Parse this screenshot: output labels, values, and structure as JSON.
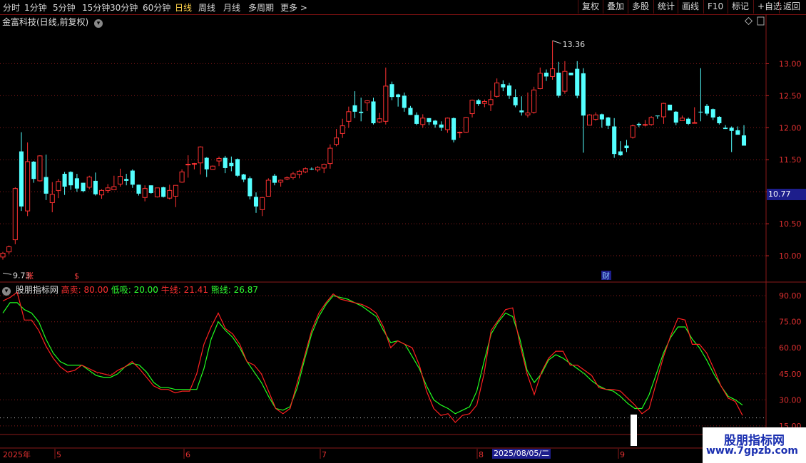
{
  "toolbar": {
    "periods": [
      "分时",
      "1分钟",
      "5分钟",
      "15分钟",
      "30分钟",
      "60分钟",
      "日线",
      "周线",
      "月线",
      "多周期",
      "更多 >"
    ],
    "active_period": "日线",
    "actions": [
      "复权",
      "叠加",
      "多股",
      "统计",
      "画线",
      "F10",
      "标记",
      "+自选",
      "返回"
    ]
  },
  "chart_title": "金富科技(日线,前复权)",
  "indicator": {
    "name": "股朋指标网",
    "items": [
      {
        "label": "高卖: 80.00",
        "color": "#ff3030"
      },
      {
        "label": "低吸: 20.00",
        "color": "#30ff30"
      },
      {
        "label": "牛线: 21.41",
        "color": "#ff3030"
      },
      {
        "label": "熊线: 26.87",
        "color": "#30ff30"
      }
    ]
  },
  "current_price": "10.77",
  "markers": {
    "high": "13.36",
    "low": "9.73",
    "tag1": "涨",
    "tag2": "$",
    "tag3": "财"
  },
  "date_axis": {
    "start": "2025年",
    "months": [
      "5",
      "6",
      "7",
      "8",
      "9"
    ],
    "cursor_date": "2025/08/05/二"
  },
  "watermark": {
    "line1": "股朋指标网",
    "line2": "www.7gpzb.com"
  },
  "colors": {
    "up": "#ff3232",
    "down": "#54ffff",
    "bull": "#ff2020",
    "bear": "#20ff20",
    "grid": "#8a1a1a"
  },
  "chart_data": {
    "type": "candlestick",
    "price_ticks": [
      10.0,
      10.5,
      11.0,
      11.5,
      12.0,
      12.5,
      13.0
    ],
    "price_ylim": [
      9.6,
      13.55
    ],
    "indicator_ticks": [
      15.0,
      30.0,
      45.0,
      60.0,
      75.0,
      90.0
    ],
    "indicator_ylim": [
      10,
      95
    ],
    "candles": [
      [
        9.98,
        10.04,
        9.94,
        10.06
      ],
      [
        10.06,
        10.14,
        10.02,
        10.16
      ],
      [
        10.25,
        11.05,
        10.18,
        11.07
      ],
      [
        11.63,
        10.77,
        10.7,
        11.93
      ],
      [
        10.7,
        11.47,
        10.62,
        11.77
      ],
      [
        11.47,
        11.2,
        11.14,
        11.48
      ],
      [
        11.17,
        11.56,
        11.16,
        11.57
      ],
      [
        11.23,
        10.97,
        10.87,
        11.58
      ],
      [
        10.83,
        10.96,
        10.68,
        11.15
      ],
      [
        11.02,
        11.16,
        10.9,
        11.2
      ],
      [
        11.28,
        11.08,
        10.95,
        11.31
      ],
      [
        11.31,
        11.1,
        11.03,
        11.32
      ],
      [
        11.21,
        11.05,
        11.0,
        11.28
      ],
      [
        11.14,
        11.01,
        10.99,
        11.14
      ],
      [
        11.07,
        11.23,
        11.04,
        11.25
      ],
      [
        11.17,
        10.96,
        10.94,
        11.3
      ],
      [
        10.95,
        11.02,
        10.89,
        11.04
      ],
      [
        11.02,
        11.06,
        10.98,
        11.12
      ],
      [
        11.03,
        11.08,
        11.03,
        11.25
      ],
      [
        11.12,
        11.24,
        11.08,
        11.36
      ],
      [
        11.2,
        11.17,
        11.1,
        11.28
      ],
      [
        11.33,
        11.11,
        11.06,
        11.35
      ],
      [
        11.11,
        10.97,
        10.94,
        11.11
      ],
      [
        10.91,
        11.05,
        10.85,
        11.1
      ],
      [
        11.1,
        10.98,
        10.97,
        11.1
      ],
      [
        10.92,
        11.06,
        10.91,
        11.06
      ],
      [
        11.07,
        10.92,
        10.91,
        11.08
      ],
      [
        10.9,
        11.02,
        10.88,
        11.11
      ],
      [
        10.93,
        11.1,
        10.76,
        11.1
      ],
      [
        11.15,
        11.31,
        11.14,
        11.35
      ],
      [
        11.43,
        11.43,
        11.22,
        11.57
      ],
      [
        11.43,
        11.44,
        11.35,
        11.45
      ],
      [
        11.45,
        11.7,
        11.27,
        11.71
      ],
      [
        11.53,
        11.35,
        11.23,
        11.54
      ],
      [
        11.35,
        11.4,
        11.37,
        11.41
      ],
      [
        11.48,
        11.52,
        11.4,
        11.55
      ],
      [
        11.53,
        11.37,
        11.29,
        11.56
      ],
      [
        11.45,
        11.4,
        11.32,
        11.55
      ],
      [
        11.51,
        11.25,
        11.23,
        11.52
      ],
      [
        11.27,
        11.19,
        11.15,
        11.28
      ],
      [
        11.21,
        10.93,
        10.88,
        11.24
      ],
      [
        10.92,
        10.77,
        10.67,
        10.99
      ],
      [
        10.72,
        10.91,
        10.62,
        10.92
      ],
      [
        10.93,
        11.18,
        10.93,
        11.21
      ],
      [
        11.25,
        11.14,
        11.1,
        11.28
      ],
      [
        11.15,
        11.18,
        11.08,
        11.19
      ],
      [
        11.2,
        11.22,
        11.18,
        11.24
      ],
      [
        11.22,
        11.28,
        11.19,
        11.31
      ],
      [
        11.27,
        11.32,
        11.21,
        11.34
      ],
      [
        11.31,
        11.36,
        11.29,
        11.38
      ],
      [
        11.36,
        11.35,
        11.34,
        11.38
      ],
      [
        11.34,
        11.38,
        11.31,
        11.4
      ],
      [
        11.37,
        11.43,
        11.29,
        11.44
      ],
      [
        11.44,
        11.68,
        11.36,
        11.74
      ],
      [
        11.74,
        11.84,
        11.71,
        11.98
      ],
      [
        11.91,
        12.03,
        11.84,
        12.14
      ],
      [
        12.1,
        12.25,
        12.0,
        12.33
      ],
      [
        12.35,
        12.25,
        12.15,
        12.57
      ],
      [
        12.25,
        12.23,
        12.1,
        12.47
      ],
      [
        12.39,
        12.42,
        12.26,
        12.43
      ],
      [
        12.41,
        12.07,
        12.05,
        12.47
      ],
      [
        12.09,
        12.14,
        12.07,
        12.23
      ],
      [
        12.1,
        12.65,
        12.05,
        12.94
      ],
      [
        12.68,
        12.48,
        12.43,
        12.72
      ],
      [
        12.52,
        12.48,
        12.33,
        12.53
      ],
      [
        12.5,
        12.31,
        12.25,
        12.55
      ],
      [
        12.31,
        12.2,
        12.2,
        12.34
      ],
      [
        12.2,
        12.06,
        12.04,
        12.24
      ],
      [
        12.05,
        12.15,
        12.0,
        12.21
      ],
      [
        12.15,
        12.09,
        12.04,
        12.15
      ],
      [
        12.11,
        12.05,
        12.0,
        12.12
      ],
      [
        12.05,
        12.0,
        11.95,
        12.1
      ],
      [
        11.97,
        12.15,
        11.92,
        12.16
      ],
      [
        12.15,
        11.81,
        11.77,
        12.16
      ],
      [
        11.93,
        11.93,
        11.84,
        11.94
      ],
      [
        11.93,
        12.16,
        11.92,
        12.17
      ],
      [
        12.22,
        12.43,
        12.16,
        12.44
      ],
      [
        12.43,
        12.37,
        12.34,
        12.45
      ],
      [
        12.38,
        12.41,
        12.32,
        12.44
      ],
      [
        12.36,
        12.44,
        12.26,
        12.58
      ],
      [
        12.49,
        12.7,
        12.47,
        12.77
      ],
      [
        12.68,
        12.63,
        12.57,
        12.74
      ],
      [
        12.66,
        12.5,
        12.45,
        12.7
      ],
      [
        12.48,
        12.35,
        12.32,
        12.6
      ],
      [
        12.27,
        12.24,
        12.19,
        12.49
      ],
      [
        12.2,
        12.23,
        12.16,
        12.55
      ],
      [
        12.24,
        12.59,
        12.22,
        12.64
      ],
      [
        12.61,
        12.85,
        12.6,
        12.94
      ],
      [
        12.86,
        12.8,
        12.73,
        12.91
      ],
      [
        12.8,
        12.92,
        12.75,
        13.36
      ],
      [
        12.86,
        12.5,
        12.47,
        13.03
      ],
      [
        12.57,
        12.88,
        12.53,
        13.04
      ],
      [
        12.86,
        12.82,
        12.82,
        12.83
      ],
      [
        12.92,
        12.5,
        12.46,
        13.04
      ],
      [
        12.85,
        12.19,
        11.61,
        12.93
      ],
      [
        12.04,
        12.2,
        12.07,
        12.21
      ],
      [
        12.13,
        12.2,
        12.11,
        12.24
      ],
      [
        12.21,
        12.13,
        12.0,
        12.22
      ],
      [
        12.16,
        12.03,
        11.98,
        12.17
      ],
      [
        12.02,
        11.59,
        11.53,
        12.15
      ],
      [
        11.63,
        11.57,
        11.56,
        11.79
      ],
      [
        11.72,
        11.68,
        11.62,
        11.81
      ],
      [
        11.85,
        12.03,
        11.83,
        12.05
      ],
      [
        12.06,
        12.04,
        12.01,
        12.08
      ],
      [
        12.04,
        12.05,
        12.02,
        12.12
      ],
      [
        12.05,
        12.16,
        12.03,
        12.18
      ],
      [
        12.19,
        12.18,
        12.14,
        12.18
      ],
      [
        12.17,
        12.38,
        12.06,
        12.39
      ],
      [
        12.36,
        12.27,
        12.28,
        12.36
      ],
      [
        12.25,
        12.08,
        12.04,
        12.26
      ],
      [
        12.11,
        12.15,
        12.12,
        12.19
      ],
      [
        12.14,
        12.06,
        12.04,
        12.16
      ],
      [
        12.08,
        12.08,
        12.08,
        12.32
      ],
      [
        12.25,
        12.24,
        12.1,
        12.93
      ],
      [
        12.34,
        12.22,
        12.19,
        12.37
      ],
      [
        12.29,
        12.16,
        12.12,
        12.3
      ],
      [
        12.17,
        12.07,
        12.05,
        12.18
      ],
      [
        12.0,
        11.98,
        11.98,
        12.04
      ],
      [
        12.0,
        11.95,
        11.62,
        12.02
      ],
      [
        11.96,
        11.89,
        11.91,
        12.02
      ],
      [
        11.88,
        11.72,
        11.73,
        12.04
      ]
    ],
    "bull_line": [
      87,
      89,
      92,
      76,
      76,
      70,
      61,
      54,
      49,
      46,
      47,
      50,
      48,
      46,
      45,
      44,
      47,
      49,
      52,
      48,
      43,
      38,
      36,
      36,
      34,
      35,
      35,
      45,
      62,
      72,
      80,
      71,
      68,
      62,
      52,
      50,
      45,
      35,
      25,
      22,
      25,
      40,
      55,
      70,
      80,
      86,
      91,
      88,
      87,
      86,
      85,
      83,
      80,
      72,
      60,
      64,
      62,
      60,
      50,
      35,
      25,
      21,
      22,
      17,
      21,
      22,
      27,
      45,
      70,
      76,
      82,
      83,
      62,
      45,
      33,
      46,
      54,
      58,
      58,
      50,
      50,
      47,
      44,
      37,
      36,
      36,
      35,
      31,
      27,
      22,
      25,
      40,
      55,
      67,
      77,
      76,
      62,
      62,
      57,
      48,
      38,
      31,
      29,
      21
    ],
    "bear_line": [
      80,
      86,
      86,
      82,
      80,
      75,
      65,
      57,
      52,
      50,
      50,
      50,
      47,
      44,
      43,
      43,
      45,
      49,
      51,
      50,
      46,
      40,
      37,
      37,
      36,
      36,
      36,
      36,
      48,
      65,
      75,
      70,
      66,
      60,
      52,
      46,
      40,
      32,
      25,
      24,
      26,
      37,
      53,
      68,
      78,
      85,
      90,
      89,
      88,
      86,
      84,
      81,
      78,
      70,
      63,
      64,
      62,
      55,
      48,
      38,
      30,
      27,
      25,
      22,
      24,
      26,
      35,
      52,
      68,
      75,
      80,
      78,
      65,
      47,
      40,
      45,
      53,
      56,
      54,
      51,
      48,
      45,
      41,
      38,
      36,
      35,
      32,
      28,
      25,
      25,
      33,
      45,
      57,
      66,
      72,
      72,
      65,
      60,
      53,
      45,
      38,
      32,
      30,
      27
    ]
  }
}
